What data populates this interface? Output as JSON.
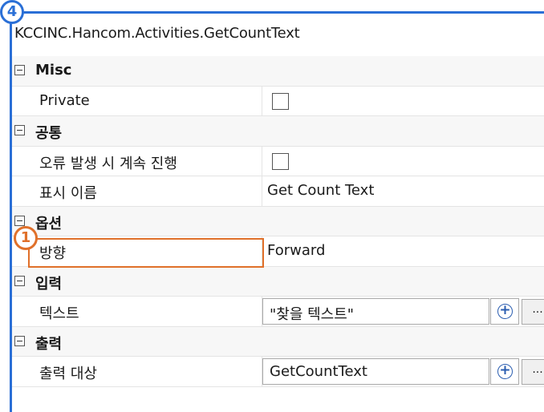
{
  "badges": {
    "top": "4",
    "marker": "1"
  },
  "title": "KCCINC.Hancom.Activities.GetCountText",
  "groups": [
    {
      "label": "Misc",
      "props": [
        {
          "name": "Private",
          "type": "checkbox"
        }
      ]
    },
    {
      "label": "공통",
      "props": [
        {
          "name": "오류 발생 시 계속 진행",
          "type": "checkbox"
        },
        {
          "name": "표시 이름",
          "value": "Get Count Text"
        }
      ]
    },
    {
      "label": "옵션",
      "props": [
        {
          "name": "방향",
          "value": "Forward"
        }
      ]
    },
    {
      "label": "입력",
      "props": [
        {
          "name": "텍스트",
          "value": "\"찾을 텍스트\""
        }
      ]
    },
    {
      "label": "출력",
      "props": [
        {
          "name": "출력 대상",
          "value": "GetCountText"
        }
      ]
    }
  ],
  "buttons": {
    "plus": "+",
    "ellipsis": "..."
  },
  "colors": {
    "accent_blue": "#2a6fd6",
    "highlight_orange": "#e0702a"
  }
}
